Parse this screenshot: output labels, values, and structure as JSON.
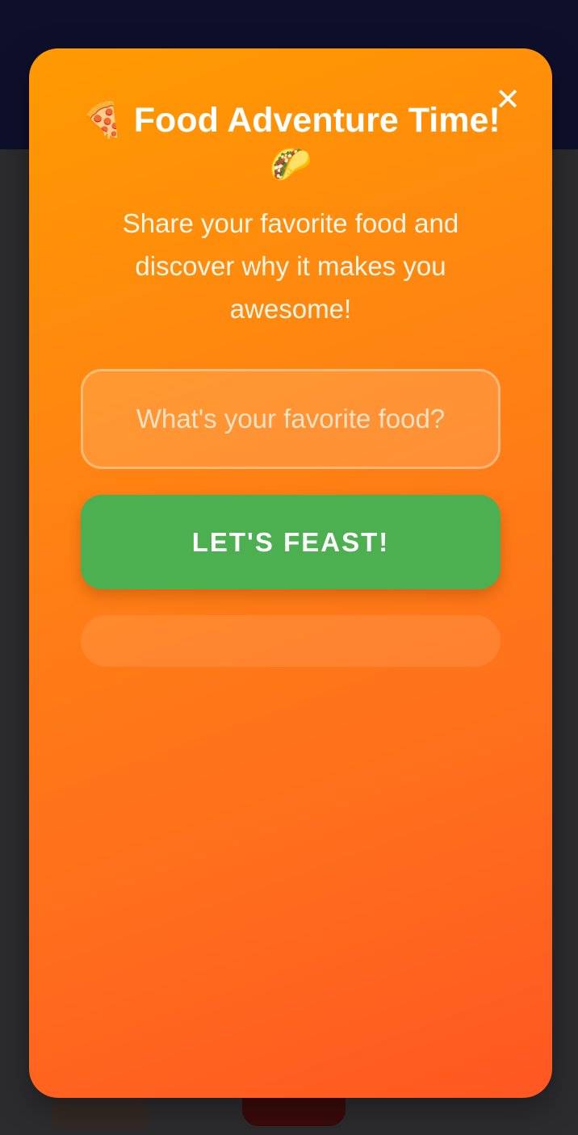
{
  "modal": {
    "title": "🍕 Food Adventure Time! 🌮",
    "subtitle": "Share your favorite food and discover why it makes you awesome!",
    "close_symbol": "✕",
    "input": {
      "placeholder": "What's your favorite food?",
      "value": ""
    },
    "submit_label": "LET'S FEAST!",
    "result_text": ""
  },
  "colors": {
    "modal_gradient_start": "#ff9a00",
    "modal_gradient_end": "#ff5722",
    "button": "#4caf50",
    "backdrop": "#2c2c2e",
    "header": "#0e0f2b"
  },
  "icons": {
    "close": "close-icon"
  }
}
